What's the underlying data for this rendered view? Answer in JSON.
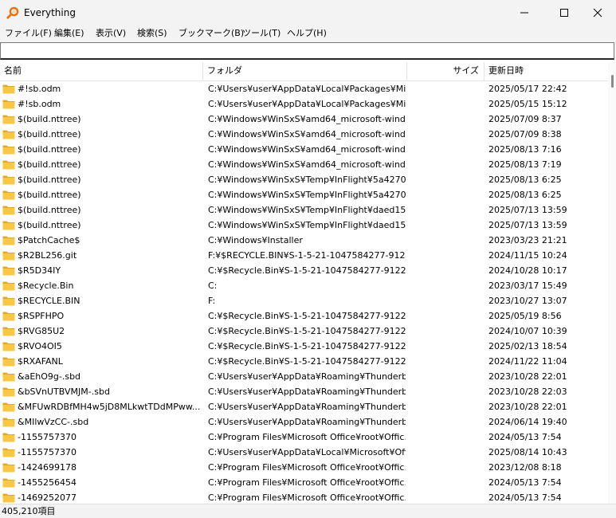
{
  "window": {
    "title": "Everything",
    "icon": "magnifier-icon"
  },
  "menu": [
    "ファイル(F)",
    "編集(E)",
    "表示(V)",
    "検索(S)",
    "ブックマーク(B)",
    "ツール(T)",
    "ヘルプ(H)"
  ],
  "search": {
    "value": ""
  },
  "columns": {
    "name": "名前",
    "folder": "フォルダ",
    "size": "サイズ",
    "modified": "更新日時"
  },
  "rows": [
    {
      "name": "#!sb.odm",
      "folder": "C:¥Users¥user¥AppData¥Local¥Packages¥Mic...",
      "size": "",
      "modified": "2025/05/17 22:42"
    },
    {
      "name": "#!sb.odm",
      "folder": "C:¥Users¥user¥AppData¥Local¥Packages¥Mic...",
      "size": "",
      "modified": "2025/05/15 15:12"
    },
    {
      "name": "$(build.nttree)",
      "folder": "C:¥Windows¥WinSxS¥amd64_microsoft-wind...",
      "size": "",
      "modified": "2025/07/09 8:37"
    },
    {
      "name": "$(build.nttree)",
      "folder": "C:¥Windows¥WinSxS¥amd64_microsoft-wind...",
      "size": "",
      "modified": "2025/07/09 8:38"
    },
    {
      "name": "$(build.nttree)",
      "folder": "C:¥Windows¥WinSxS¥amd64_microsoft-wind...",
      "size": "",
      "modified": "2025/08/13 7:16"
    },
    {
      "name": "$(build.nttree)",
      "folder": "C:¥Windows¥WinSxS¥amd64_microsoft-wind...",
      "size": "",
      "modified": "2025/08/13 7:19"
    },
    {
      "name": "$(build.nttree)",
      "folder": "C:¥Windows¥WinSxS¥Temp¥InFlight¥5a42703...",
      "size": "",
      "modified": "2025/08/13 6:25"
    },
    {
      "name": "$(build.nttree)",
      "folder": "C:¥Windows¥WinSxS¥Temp¥InFlight¥5a42703...",
      "size": "",
      "modified": "2025/08/13 6:25"
    },
    {
      "name": "$(build.nttree)",
      "folder": "C:¥Windows¥WinSxS¥Temp¥InFlight¥daed15...",
      "size": "",
      "modified": "2025/07/13 13:59"
    },
    {
      "name": "$(build.nttree)",
      "folder": "C:¥Windows¥WinSxS¥Temp¥InFlight¥daed15...",
      "size": "",
      "modified": "2025/07/13 13:59"
    },
    {
      "name": "$PatchCache$",
      "folder": "C:¥Windows¥Installer",
      "size": "",
      "modified": "2023/03/23 21:21"
    },
    {
      "name": "$R2BL256.git",
      "folder": "F:¥$RECYCLE.BIN¥S-1-5-21-1047584277-9122...",
      "size": "",
      "modified": "2024/11/15 10:24"
    },
    {
      "name": "$R5D34IY",
      "folder": "C:¥$Recycle.Bin¥S-1-5-21-1047584277-912222...",
      "size": "",
      "modified": "2024/10/28 10:17"
    },
    {
      "name": "$Recycle.Bin",
      "folder": "C:",
      "size": "",
      "modified": "2023/03/17 15:49"
    },
    {
      "name": "$RECYCLE.BIN",
      "folder": "F:",
      "size": "",
      "modified": "2023/10/27 13:07"
    },
    {
      "name": "$RSPFHPO",
      "folder": "C:¥$Recycle.Bin¥S-1-5-21-1047584277-912222...",
      "size": "",
      "modified": "2025/05/19 8:56"
    },
    {
      "name": "$RVG85U2",
      "folder": "C:¥$Recycle.Bin¥S-1-5-21-1047584277-912222...",
      "size": "",
      "modified": "2024/10/07 10:39"
    },
    {
      "name": "$RVO4OI5",
      "folder": "C:¥$Recycle.Bin¥S-1-5-21-1047584277-912222...",
      "size": "",
      "modified": "2025/02/13 18:54"
    },
    {
      "name": "$RXAFANL",
      "folder": "C:¥$Recycle.Bin¥S-1-5-21-1047584277-912222...",
      "size": "",
      "modified": "2024/11/22 11:04"
    },
    {
      "name": "&aEhO9g-.sbd",
      "folder": "C:¥Users¥user¥AppData¥Roaming¥Thunderbi...",
      "size": "",
      "modified": "2023/10/28 22:01"
    },
    {
      "name": "&bSVnUTBVMJM-.sbd",
      "folder": "C:¥Users¥user¥AppData¥Roaming¥Thunderbi...",
      "size": "",
      "modified": "2023/10/28 22:03"
    },
    {
      "name": "&MFUwRDBfMH4w5jD8MLkwtTDdMPww...",
      "folder": "C:¥Users¥user¥AppData¥Roaming¥Thunderbi...",
      "size": "",
      "modified": "2023/10/28 22:01"
    },
    {
      "name": "&MIlwVzCC-.sbd",
      "folder": "C:¥Users¥user¥AppData¥Roaming¥Thunderbi...",
      "size": "",
      "modified": "2024/06/14 19:40"
    },
    {
      "name": "-1155757370",
      "folder": "C:¥Program Files¥Microsoft Office¥root¥Offic...",
      "size": "",
      "modified": "2024/05/13 7:54"
    },
    {
      "name": "-1155757370",
      "folder": "C:¥Users¥user¥AppData¥Local¥Microsoft¥Off...",
      "size": "",
      "modified": "2025/08/14 10:43"
    },
    {
      "name": "-1424699178",
      "folder": "C:¥Program Files¥Microsoft Office¥root¥Offic...",
      "size": "",
      "modified": "2023/12/08 8:18"
    },
    {
      "name": "-1455256454",
      "folder": "C:¥Program Files¥Microsoft Office¥root¥Offic...",
      "size": "",
      "modified": "2024/05/13 7:54"
    },
    {
      "name": "-1469252077",
      "folder": "C:¥Program Files¥Microsoft Office¥root¥Offic...",
      "size": "",
      "modified": "2024/05/13 7:54"
    }
  ],
  "status": {
    "count": "405,210項目"
  },
  "colors": {
    "folder": "#f8c844",
    "folder_dark": "#e2a82a",
    "icon_orange": "#e8730c"
  }
}
